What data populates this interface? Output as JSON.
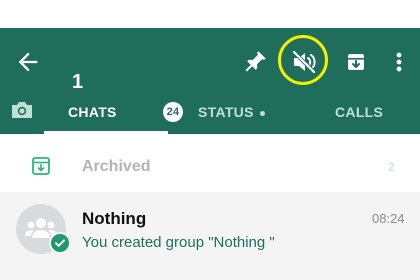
{
  "selection_bar": {
    "selected_count": "1",
    "actions": [
      "back-icon",
      "pin-icon",
      "mute-icon",
      "archive-icon",
      "more-vert-icon"
    ],
    "highlighted_action": "mute-icon",
    "highlight_color": "#f5f000"
  },
  "tabs": {
    "camera_icon": "camera-icon",
    "items": [
      {
        "label": "CHATS",
        "badge": "24",
        "selected": true
      },
      {
        "label": "STATUS",
        "has_dot": true,
        "selected": false
      },
      {
        "label": "CALLS",
        "selected": false
      }
    ]
  },
  "archived": {
    "icon": "archive-box-icon",
    "label": "Archived",
    "count": "2"
  },
  "chats": [
    {
      "name": "Nothing",
      "time": "08:24",
      "preview": "You created group \"Nothing \"",
      "avatar": "group-avatar-icon",
      "selected_badge": "check-icon"
    }
  ],
  "colors": {
    "primary": "#1f6e5c",
    "tab_inactive": "#bfe0d5",
    "check_badge": "#1f9a6f",
    "selected_row_bg": "#f4f4f4"
  }
}
